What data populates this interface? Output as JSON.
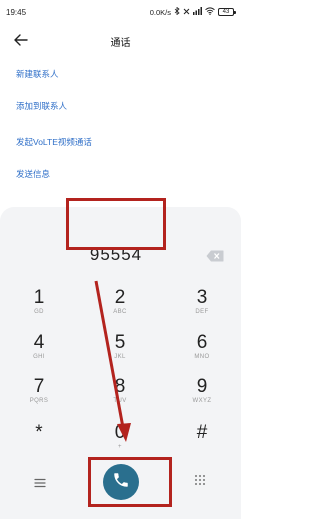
{
  "status_bar": {
    "time": "19:45",
    "network_speed": "0.0K/s",
    "battery": "43"
  },
  "header": {
    "title": "通话",
    "back_icon": "back-arrow-icon"
  },
  "actions": [
    {
      "label": "新建联系人"
    },
    {
      "label": "添加到联系人"
    },
    {
      "label": "发起VoLTE视频通话"
    },
    {
      "label": "发送信息"
    }
  ],
  "dialer": {
    "number": "95554",
    "keys": [
      {
        "digit": "1",
        "letters": "GD"
      },
      {
        "digit": "2",
        "letters": "ABC"
      },
      {
        "digit": "3",
        "letters": "DEF"
      },
      {
        "digit": "4",
        "letters": "GHI"
      },
      {
        "digit": "5",
        "letters": "JKL"
      },
      {
        "digit": "6",
        "letters": "MNO"
      },
      {
        "digit": "7",
        "letters": "PQRS"
      },
      {
        "digit": "8",
        "letters": "TUV"
      },
      {
        "digit": "9",
        "letters": "WXYZ"
      },
      {
        "digit": "*",
        "letters": ""
      },
      {
        "digit": "0",
        "letters": "+"
      },
      {
        "digit": "#",
        "letters": ""
      }
    ]
  },
  "colors": {
    "link": "#2f6fc8",
    "highlight": "#b3231e",
    "call": "#2a6f8e",
    "pad_bg": "#f3f4f6"
  }
}
